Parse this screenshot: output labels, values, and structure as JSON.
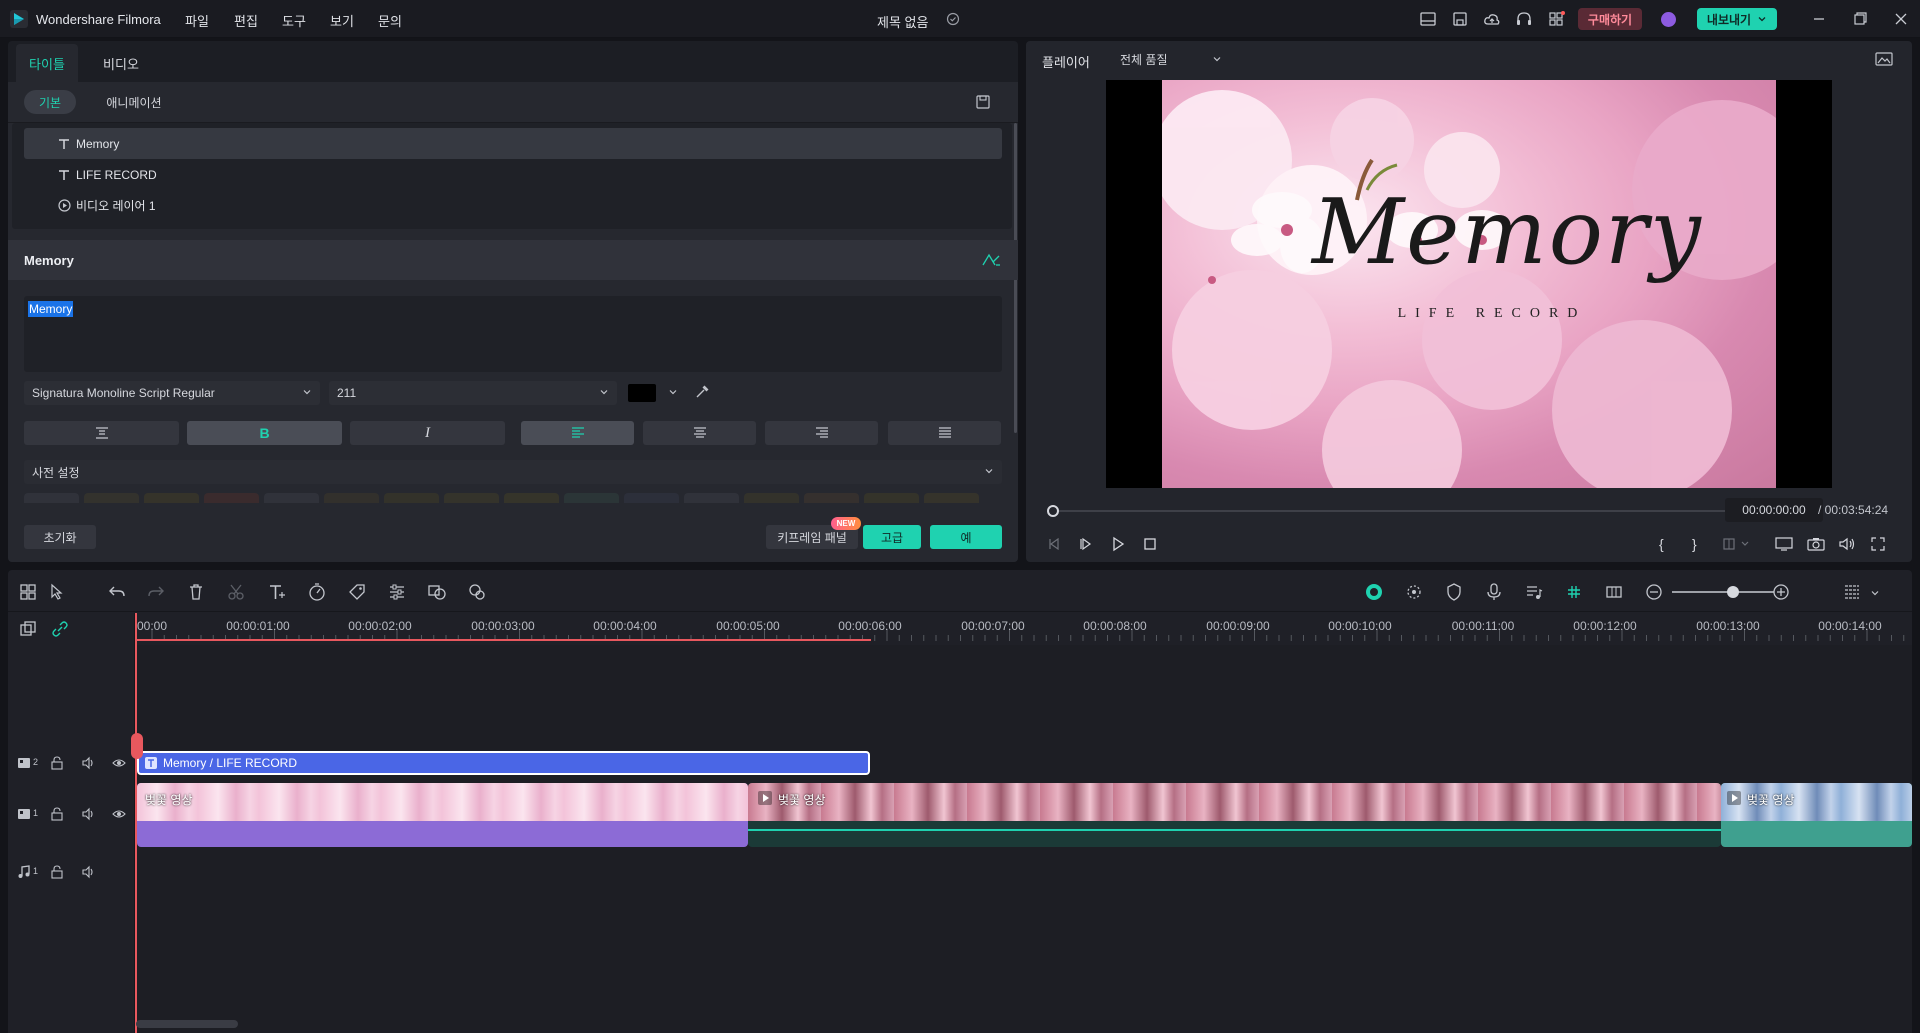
{
  "app": {
    "name": "Wondershare Filmora",
    "project_title": "제목 없음",
    "menu": [
      "파일",
      "편집",
      "도구",
      "보기",
      "문의"
    ],
    "buy_label": "구매하기",
    "export_label": "내보내기",
    "colors": {
      "accent": "#1fd2b0",
      "buy": "#f06a7e",
      "title_clip": "#4a66e6",
      "video_clip": "#8c6bd6",
      "playhead": "#e8585e"
    }
  },
  "editor": {
    "tabs": [
      "타이틀",
      "비디오"
    ],
    "subtabs": [
      "기본",
      "애니메이션"
    ],
    "layers": [
      {
        "icon": "text-icon",
        "label": "Memory"
      },
      {
        "icon": "text-icon",
        "label": "LIFE RECORD"
      },
      {
        "icon": "video-layer-icon",
        "label": "비디오 레이어 1"
      }
    ],
    "section_title": "Memory",
    "text_value": "Memory",
    "font_name": "Signatura Monoline Script Regular",
    "font_size": "211",
    "preset_label": "사전 설정",
    "reset_label": "초기화",
    "keyframe_label": "키프레임 패널",
    "new_badge": "NEW",
    "advanced_label": "고급",
    "ok_label": "예"
  },
  "player": {
    "title": "플레이어",
    "quality": "전체 품질",
    "preview_title": "Memory",
    "preview_subtitle": "LIFE RECORD",
    "current_time": "00:00:00:00",
    "total_time": "/ 00:03:54:24",
    "progress": 0.0
  },
  "timeline": {
    "ticks": [
      "00:00",
      "00:00:01:00",
      "00:00:02:00",
      "00:00:03:00",
      "00:00:04:00",
      "00:00:05:00",
      "00:00:06:00",
      "00:00:07:00",
      "00:00:08:00",
      "00:00:09:00",
      "00:00:10:00",
      "00:00:11:00",
      "00:00:12:00",
      "00:00:13:00",
      "00:00:14:00"
    ],
    "tracks": [
      {
        "id": "2",
        "type": "video"
      },
      {
        "id": "1",
        "type": "video"
      },
      {
        "id": "1",
        "type": "audio"
      }
    ],
    "title_clip_label": "Memory / LIFE RECORD",
    "video_clip_labels": [
      "벚꽃 영상",
      "벚꽃 영상",
      "벚꽃 영상"
    ]
  }
}
